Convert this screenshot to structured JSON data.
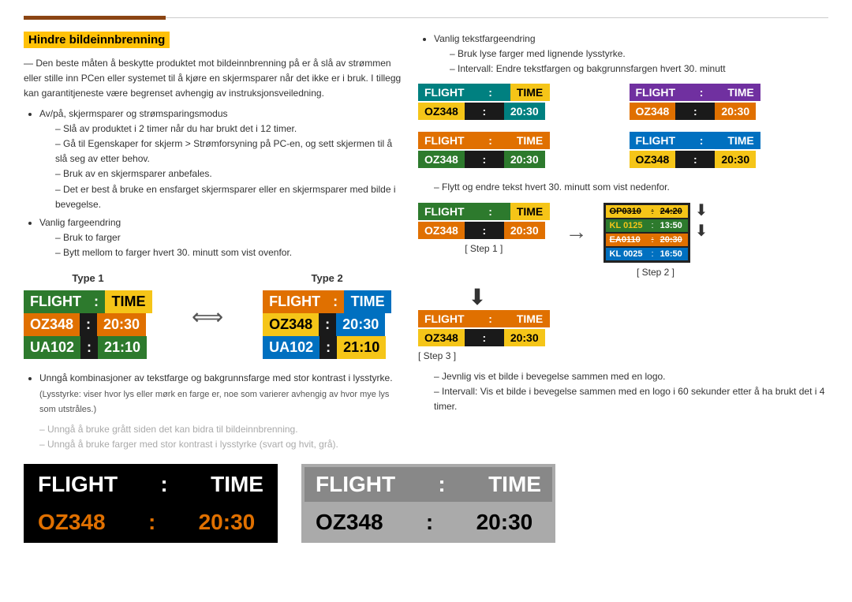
{
  "header": {
    "accent_bar_note": "top accent line"
  },
  "section": {
    "title": "Hindre bildeinnbrenning",
    "intro": "Den beste måten å beskytte produktet mot bildeinnbrenning på er å slå av strømmen eller stille inn PCen eller systemet til å kjøre en skjermsparer når det ikke er i bruk. I tillegg kan garantitjeneste være begrenset avhengig av instruksjonsveiledning.",
    "bullet1": "Av/på, skjermsparer og strømsparingsmodus",
    "dash1": "Slå av produktet i 2 timer når du har brukt det i 12 timer.",
    "dash2": "Gå til Egenskaper for skjerm > Strømforsyning på PC-en, og sett skjermen til å slå seg av etter behov.",
    "dash3": "Bruk av en skjermsparer anbefales.",
    "dash4": "Det er best å bruke en ensfarget skjermsparer eller en skjermsparer med bilde i bevegelse.",
    "bullet2": "Vanlig fargeendring",
    "dash5": "Bruk to farger",
    "dash6": "Bytt mellom to farger hvert 30. minutt som vist ovenfor.",
    "type1_label": "Type 1",
    "type2_label": "Type 2",
    "bullet3": "Unngå kombinasjoner av tekstfarge og bakgrunnsfarge med stor kontrast i lysstyrke.",
    "paren1": "(Lysstyrke: viser hvor lys eller mørk en farge er, noe som varierer avhengig av hvor mye lys som utstråles.)",
    "dash7": "Unngå å bruke grått siden det kan bidra til bildeinnbrenning.",
    "dash8": "Unngå å bruke farger med stor kontrast i lysstyrke (svart og hvit, grå)."
  },
  "right_section": {
    "bullet_vc": "Vanlig tekstfargeendring",
    "dash_vc1": "Bruk lyse farger med lignende lysstyrke.",
    "dash_vc2": "Intervall: Endre tekstfargen og bakgrunnsfargen hvert 30. minutt",
    "dash_move": "Flytt og endre tekst hvert 30. minutt som vist nedenfor.",
    "step1_label": "[ Step 1 ]",
    "step2_label": "[ Step 2 ]",
    "step3_label": "[ Step 3 ]",
    "dash_logo": "Jevnlig vis et bilde i bevegelse sammen med en logo.",
    "dash_logo2": "Intervall: Vis et bilde i bevegelse sammen med en logo i 60 sekunder etter å ha brukt det i 4 timer."
  },
  "boards": {
    "type1": {
      "header": [
        "FLIGHT",
        ":",
        "TIME"
      ],
      "row1": [
        "OZ348",
        ":",
        "20:30"
      ],
      "row2": [
        "UA102",
        ":",
        "21:10"
      ]
    },
    "type2": {
      "header": [
        "FLIGHT",
        ":",
        "TIME"
      ],
      "row1": [
        "OZ348",
        ":",
        "20:30"
      ],
      "row2": [
        "UA102",
        ":",
        "21:10"
      ]
    },
    "bottom_black": {
      "header": [
        "FLIGHT",
        ":",
        "TIME"
      ],
      "row1": [
        "OZ348",
        ":",
        "20:30"
      ]
    },
    "bottom_gray": {
      "header": [
        "FLIGHT",
        ":",
        "TIME"
      ],
      "row1": [
        "OZ348",
        ":",
        "20:30"
      ]
    },
    "right_teal_yellow": {
      "header": [
        "FLIGHT",
        ":",
        "TIME"
      ],
      "row1": [
        "OZ348",
        ":",
        "20:30"
      ]
    },
    "right_purple_orange": {
      "header": [
        "FLIGHT",
        ":",
        "TIME"
      ],
      "row1": [
        "OZ348",
        ":",
        "20:30"
      ]
    },
    "right_orange_green": {
      "header": [
        "FLIGHT",
        ":",
        "TIME"
      ],
      "row1": [
        "OZ348",
        ":",
        "20:30"
      ]
    },
    "right_blue_yellow": {
      "header": [
        "FLIGHT",
        ":",
        "TIME"
      ],
      "row1": [
        "OZ348",
        ":",
        "20:30"
      ]
    },
    "step1": {
      "header": [
        "FLIGHT",
        ":",
        "TIME"
      ],
      "row1": [
        "OZ348",
        ":",
        "20:30"
      ]
    },
    "step3": {
      "header": [
        "FLIGHT",
        ":",
        "TIME"
      ],
      "row1": [
        "OZ348",
        ":",
        "20:30"
      ]
    }
  }
}
